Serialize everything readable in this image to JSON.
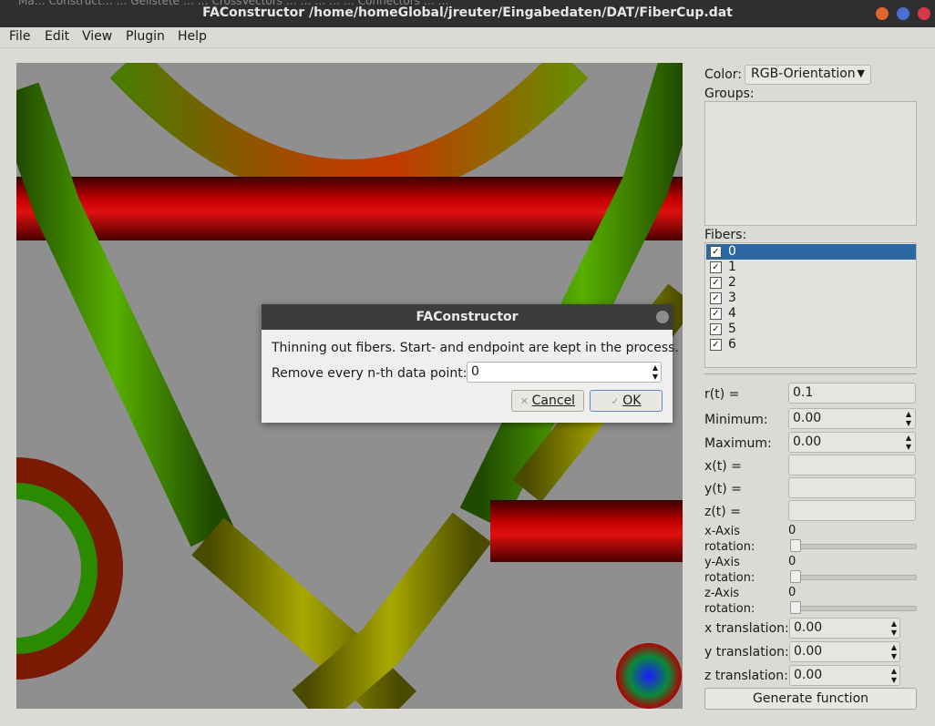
{
  "window": {
    "title": "FAConstructor /home/homeGlobal/jreuter/Eingabedaten/DAT/FiberCup.dat",
    "background_titles": "Ma… Construct… … Gelistete … … CrossVectors … … … … … Connectors … …"
  },
  "menu": [
    "File",
    "Edit",
    "View",
    "Plugin",
    "Help"
  ],
  "panel": {
    "color_label": "Color:",
    "color_value": "RGB-Orientation",
    "groups_label": "Groups:",
    "fibers_label": "Fibers:",
    "fibers": [
      {
        "label": "0",
        "checked": true,
        "selected": true
      },
      {
        "label": "1",
        "checked": true
      },
      {
        "label": "2",
        "checked": true
      },
      {
        "label": "3",
        "checked": true
      },
      {
        "label": "4",
        "checked": true
      },
      {
        "label": "5",
        "checked": true
      },
      {
        "label": "6",
        "checked": true
      }
    ],
    "rt_label": "r(t) =",
    "rt_value": "0.1",
    "minimum_label": "Minimum:",
    "minimum_value": "0.00",
    "maximum_label": "Maximum:",
    "maximum_value": "0.00",
    "xt_label": "x(t) =",
    "yt_label": "y(t) =",
    "zt_label": "z(t) =",
    "x_axis_line1": "x-Axis",
    "x_axis_line2": "rotation:",
    "x_axis_value": "0",
    "y_axis_line1": "y-Axis",
    "y_axis_line2": "rotation:",
    "y_axis_value": "0",
    "z_axis_line1": "z-Axis",
    "z_axis_line2": "rotation:",
    "z_axis_value": "0",
    "x_translation_label": "x translation:",
    "x_translation_value": "0.00",
    "y_translation_label": "y translation:",
    "y_translation_value": "0.00",
    "z_translation_label": "z translation:",
    "z_translation_value": "0.00",
    "generate_button": "Generate function"
  },
  "dialog": {
    "title": "FAConstructor",
    "message": "Thinning out fibers. Start- and endpoint are kept in the process.",
    "field_label": "Remove every n-th data point:",
    "field_value": "0",
    "cancel": "Cancel",
    "ok": "OK"
  },
  "colors": {
    "titlebar": "#2e2f31",
    "selection": "#2a67a3",
    "fiber_red": "#b00000",
    "fiber_green": "#3f8f00",
    "fiber_yellow": "#8f8f00",
    "viewport_bg": "#8f8f8f"
  }
}
